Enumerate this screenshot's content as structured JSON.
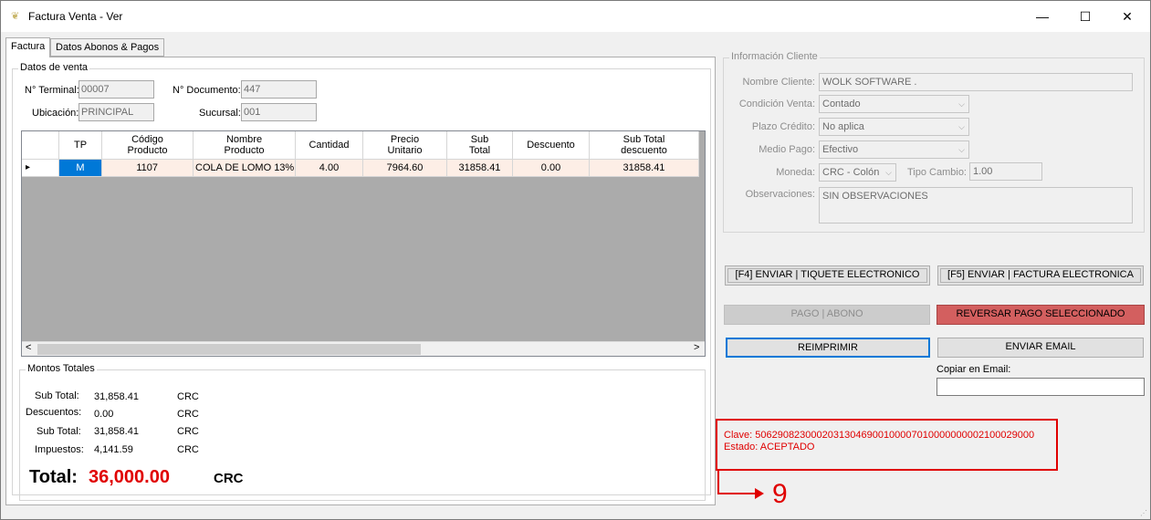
{
  "window": {
    "title": "Factura Venta - Ver",
    "minimize": "—",
    "maximize": "☐",
    "close": "✕"
  },
  "tabs": [
    "Factura",
    "Datos Abonos & Pagos"
  ],
  "datos_venta": {
    "title": "Datos de venta",
    "terminal_label": "N° Terminal:",
    "terminal_value": "00007",
    "documento_label": "N° Documento:",
    "documento_value": "447",
    "ubicacion_label": "Ubicación:",
    "ubicacion_value": "PRINCIPAL",
    "sucursal_label": "Sucursal:",
    "sucursal_value": "001"
  },
  "grid": {
    "headers": [
      "TP",
      "Código\nProducto",
      "Nombre\nProducto",
      "Cantidad",
      "Precio\nUnitario",
      "Sub\nTotal",
      "Descuento",
      "Sub Total\ndescuento"
    ],
    "rows": [
      {
        "tp": "M",
        "codigo": "1107",
        "nombre": "COLA DE LOMO 13%",
        "cantidad": "4.00",
        "precio": "7964.60",
        "subtotal": "31858.41",
        "descuento": "0.00",
        "subtotal_desc": "31858.41"
      }
    ],
    "scroll_left": "<",
    "scroll_right": ">",
    "row_indicator": "▸"
  },
  "montos": {
    "title": "Montos Totales",
    "rows": [
      {
        "label": "Sub Total:",
        "value": "31,858.41",
        "currency": "CRC"
      },
      {
        "label": "Descuentos:",
        "value": "0.00",
        "currency": "CRC"
      },
      {
        "label": "Sub Total:",
        "value": "31,858.41",
        "currency": "CRC"
      },
      {
        "label": "Impuestos:",
        "value": "4,141.59",
        "currency": "CRC"
      }
    ],
    "total_label": "Total:",
    "total_value": "36,000.00",
    "total_currency": "CRC"
  },
  "cliente": {
    "title": "Información Cliente",
    "nombre_label": "Nombre Cliente:",
    "nombre_value": "WOLK SOFTWARE .",
    "condicion_label": "Condición Venta:",
    "condicion_value": "Contado",
    "plazo_label": "Plazo Crédito:",
    "plazo_value": "No aplica",
    "medio_label": "Medio Pago:",
    "medio_value": "Efectivo",
    "moneda_label": "Moneda:",
    "moneda_value": "CRC - Colón",
    "tipo_cambio_label": "Tipo Cambio:",
    "tipo_cambio_value": "1.00",
    "obs_label": "Observaciones:",
    "obs_value": "SIN OBSERVACIONES"
  },
  "buttons": {
    "tiquete": "[F4] ENVIAR | TIQUETE ELECTRONICO",
    "factura": "[F5] ENVIAR | FACTURA ELECTRONICA",
    "pago": "PAGO | ABONO",
    "reversar": "REVERSAR PAGO SELECCIONADO",
    "reimprimir": "REIMPRIMIR",
    "email": "ENVIAR EMAIL"
  },
  "email": {
    "label": "Copiar en Email:",
    "value": ""
  },
  "status": {
    "clave": "Clave: 50629082300020313046900100007010000000002100029000",
    "estado": "Estado: ACEPTADO"
  },
  "annotation": {
    "number": "9"
  },
  "colors": {
    "accent_red": "#e00000",
    "reversar_bg": "#d35f5f",
    "selected_cell": "#0078d7",
    "row_bg": "#fdeee6"
  }
}
